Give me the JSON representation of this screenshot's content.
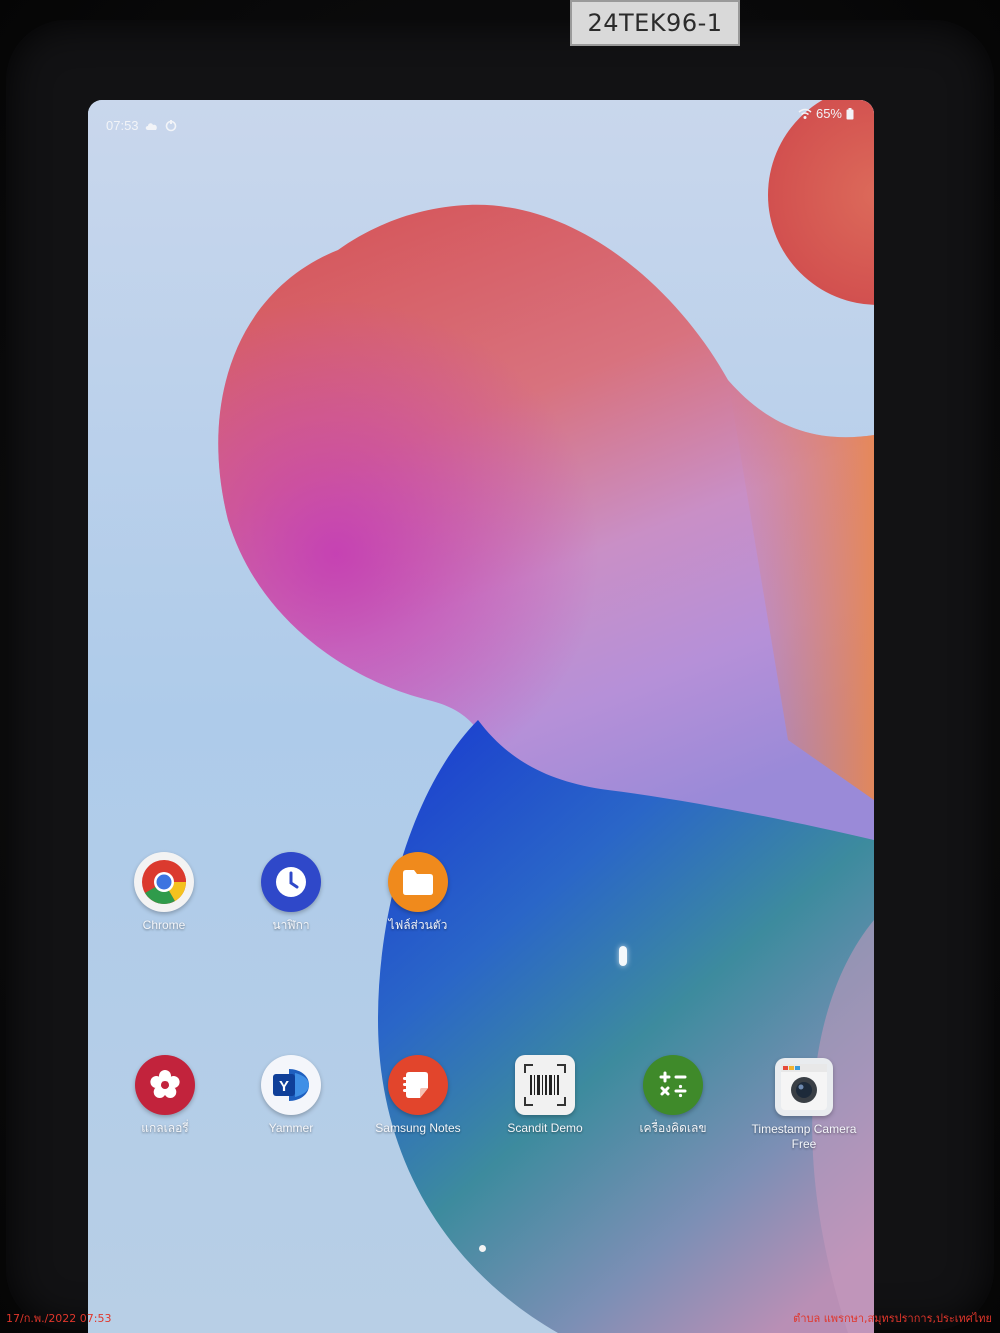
{
  "device": {
    "asset_tag": "24TEK96-1"
  },
  "status_bar": {
    "time": "07:53",
    "battery": "65%"
  },
  "home_screen": {
    "row1": [
      {
        "label": "Chrome",
        "icon": "chrome-icon"
      },
      {
        "label": "นาฬิกา",
        "icon": "clock-icon"
      },
      {
        "label": "ไฟล์ส่วนตัว",
        "icon": "folder-icon"
      }
    ],
    "row2": [
      {
        "label": "แกลเลอรี่",
        "icon": "gallery-flower-icon"
      },
      {
        "label": "Yammer",
        "icon": "yammer-icon"
      },
      {
        "label": "Samsung Notes",
        "icon": "samsung-notes-icon"
      },
      {
        "label": "Scandit Demo",
        "icon": "barcode-scanner-icon"
      },
      {
        "label": "เครื่องคิดเลข",
        "icon": "calculator-icon"
      },
      {
        "label": "Timestamp Camera Free",
        "icon": "camera-icon"
      }
    ],
    "page_indicator": {
      "pages": 1,
      "current": 1
    }
  },
  "photo_overlay": {
    "timestamp": "17/ก.พ./2022 07:53",
    "location": "ตำบล แพรกษา,สมุทรปราการ,ประเทศไทย"
  },
  "colors": {
    "wallpaper_bg": "#b9cfe7",
    "blob_red": "#d8625c",
    "blob_magenta": "#c24fc0",
    "blob_blue": "#2c4fd6",
    "blob_teal": "#3a8fa0",
    "clock_icon": "#2f48c9",
    "folder_icon": "#f08a1c",
    "gallery_icon": "#c2233c",
    "notes_icon": "#e2452c",
    "calculator_icon": "#3f8a2a",
    "stamp_text": "#e0362b"
  }
}
